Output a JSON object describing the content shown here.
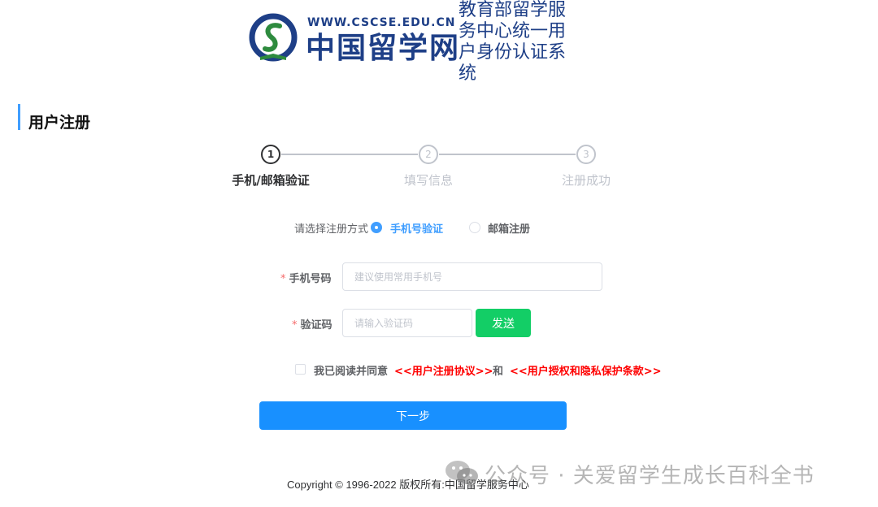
{
  "header": {
    "logo_url_text": "WWW.CSCSE.EDU.CN",
    "logo_cn_text": "中国留学网",
    "system_title": "教育部留学服务中心统一用户身份认证系统"
  },
  "page_title": "用户注册",
  "steps": [
    {
      "number": "1",
      "label": "手机/邮箱验证",
      "active": true
    },
    {
      "number": "2",
      "label": "填写信息",
      "active": false
    },
    {
      "number": "3",
      "label": "注册成功",
      "active": false
    }
  ],
  "method": {
    "label": "请选择注册方式",
    "options": [
      "手机号验证",
      "邮箱注册"
    ],
    "selected": "手机号验证"
  },
  "form": {
    "required_mark": "*",
    "phone_label": "手机号码",
    "phone_placeholder": "建议使用常用手机号",
    "code_label": "验证码",
    "code_placeholder": "请输入验证码",
    "send_button": "发送"
  },
  "agreement": {
    "prefix": "我已阅读并同意",
    "link1": "<<用户注册协议>>",
    "conjunction": "和",
    "link2": "<<用户授权和隐私保护条款>>"
  },
  "next_button": "下一步",
  "footer": {
    "copyright": "Copyright © 1996-2022 版权所有:中国留学服务中心"
  },
  "watermark": {
    "text": "公众号 · 关爱留学生成长百科全书"
  },
  "colors": {
    "primary": "#409eff",
    "next_button": "#1890ff",
    "send_button": "#13ce66",
    "link_red": "#ff0000",
    "logo_blue": "#1e3f87"
  }
}
